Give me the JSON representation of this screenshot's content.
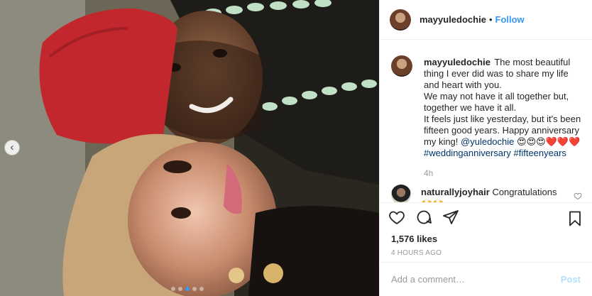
{
  "header": {
    "username": "mayyuledochie",
    "separator": "•",
    "follow_label": "Follow"
  },
  "caption": {
    "username": "mayyuledochie",
    "lines": [
      "The most beautiful thing I ever did was to share my life and heart with you.",
      "We may not have it all together but, together we have it all.",
      "It feels just like yesterday, but it's been fifteen good years. Happy anniversary my king!"
    ],
    "mention": "@yuledochie",
    "emoji": "😍😍😍❤️❤️❤️",
    "hashtags": [
      "#weddinganniversary",
      "#fifteenyears"
    ],
    "time": "4h"
  },
  "comments": [
    {
      "username": "naturallyjoyhair",
      "text": "Congratulations",
      "emoji": "🙌🙌"
    }
  ],
  "actions": {
    "like_icon": "heart-icon",
    "comment_icon": "comment-icon",
    "share_icon": "share-icon",
    "save_icon": "bookmark-icon"
  },
  "likes_text": "1,576 likes",
  "timestamp": "4 HOURS AGO",
  "add_comment": {
    "placeholder": "Add a comment…",
    "post_label": "Post"
  },
  "carousel": {
    "slide_count": 5,
    "active_index": 2
  },
  "colors": {
    "accent": "#3897f0",
    "text": "#262626",
    "muted": "#999999",
    "border": "#efefef",
    "post_disabled": "#b2dffc"
  }
}
